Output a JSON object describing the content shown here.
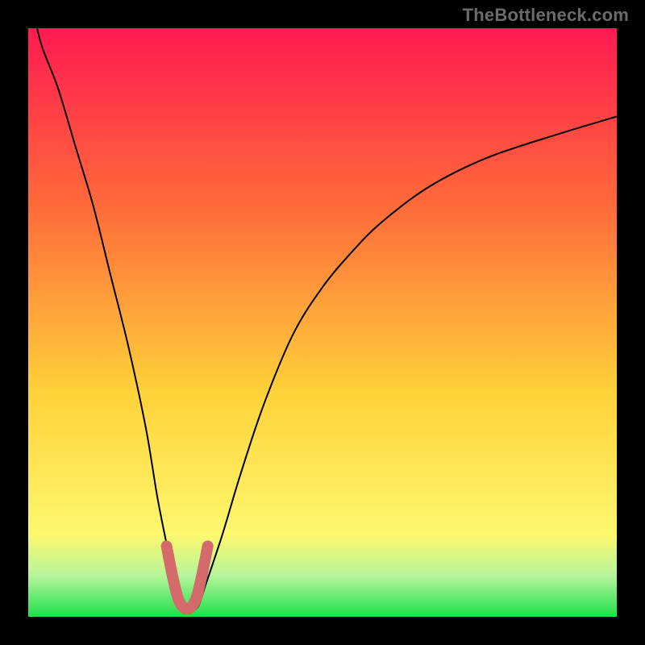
{
  "watermark": "TheBottleneck.com",
  "colors": {
    "top": "#ff1a51",
    "upper": "#ff6a3a",
    "mid": "#ffd23a",
    "low": "#fdf86e",
    "pale_green": "#b6f59a",
    "green": "#1ee04c",
    "curve": "#000000",
    "marker": "#d46a6a",
    "frame": "#000000"
  },
  "chart_data": {
    "type": "line",
    "title": "",
    "xlabel": "",
    "ylabel": "",
    "xlim": [
      0,
      100
    ],
    "ylim": [
      0,
      100
    ],
    "grid": false,
    "legend": false,
    "annotations": [
      "TheBottleneck.com"
    ],
    "series": [
      {
        "name": "bottleneck-curve",
        "x": [
          0,
          2,
          5,
          8,
          11,
          14,
          17,
          20,
          22,
          24,
          25,
          26,
          27,
          28,
          29,
          30,
          33,
          36,
          40,
          45,
          50,
          55,
          60,
          68,
          78,
          90,
          100
        ],
        "y": [
          108,
          98,
          90,
          80,
          70,
          58,
          46,
          32,
          20,
          10,
          5,
          2,
          1,
          1,
          2,
          5,
          14,
          24,
          36,
          48,
          56,
          62,
          67,
          73,
          78,
          82,
          85
        ]
      }
    ],
    "highlight": {
      "name": "minimum-marker",
      "x": [
        23.5,
        24.5,
        25.5,
        26.5,
        27.5,
        28.5,
        29.5,
        30.5
      ],
      "y": [
        12,
        7,
        3,
        1.5,
        1.5,
        3,
        7,
        12
      ]
    }
  }
}
